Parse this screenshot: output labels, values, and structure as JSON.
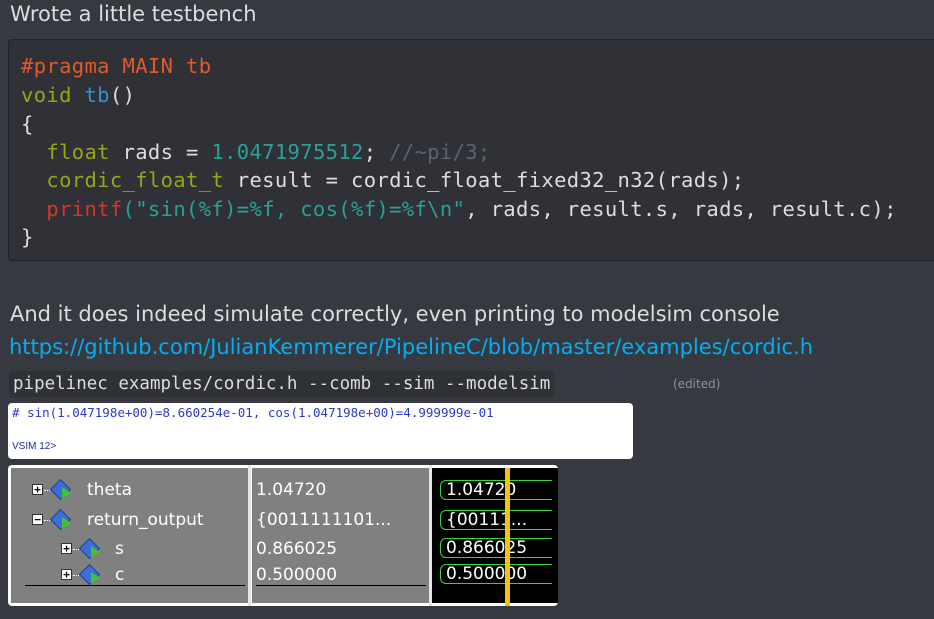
{
  "messages": {
    "intro": "Wrote a little testbench",
    "followup": "And it does indeed simulate correctly, even printing to modelsim console",
    "link": "https://github.com/JulianKemmerer/PipelineC/blob/master/examples/cordic.h",
    "command": "pipelinec examples/cordic.h --comb --sim --modelsim",
    "edited": "(edited)"
  },
  "code": {
    "line1": "#pragma MAIN tb",
    "line2_kw": "void",
    "line2_fn": "tb",
    "line2_rest": "()",
    "line3": "{",
    "line4_kw": "float",
    "line4_mid": " rads = ",
    "line4_num": "1.0471975512",
    "line4_semi": "; ",
    "line4_comment": "//~pi/3;",
    "line5_kw": "cordic_float_t",
    "line5_rest": " result = cordic_float_fixed32_n32(rads);",
    "line6_fn": "printf",
    "line6_str": "(\"sin(%f)=%f, cos(%f)=%f\\n\"",
    "line6_rest": ", rads, result.s, rads, result.c);",
    "line7": "}"
  },
  "console": {
    "output": "# sin(1.047198e+00)=8.660254e-01, cos(1.047198e+00)=4.999999e-01",
    "prompt": "VSIM 12>"
  },
  "waveform": {
    "signals": [
      {
        "name": "theta",
        "value": "1.04720",
        "wave": "1.04720"
      },
      {
        "name": "return_output",
        "value": "{0011111101...",
        "wave": "{00111..."
      },
      {
        "name": "s",
        "value": "0.866025",
        "wave": "0.866025"
      },
      {
        "name": "c",
        "value": "0.500000",
        "wave": "0.500000"
      }
    ]
  },
  "colors": {
    "background": "#36393f",
    "code_background": "#2f3136",
    "link": "#00aff4",
    "cursor": "#f2c40c",
    "wave": "#3cd23c"
  }
}
